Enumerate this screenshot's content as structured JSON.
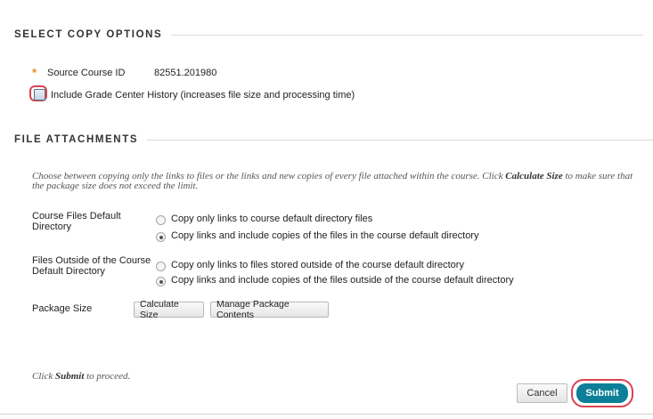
{
  "copy_options": {
    "heading": "SELECT COPY OPTIONS",
    "source_course_label": "Source Course ID",
    "source_course_id": "82551.201980",
    "required_mark": "*",
    "grade_center_history_label": "Include Grade Center History (increases file size and processing time)",
    "grade_center_history_checked": false
  },
  "file_attachments": {
    "heading": "FILE ATTACHMENTS",
    "instructions_part1": "Choose between copying only the links to files or the links and new copies of every file attached within the course. Click ",
    "instructions_bold": "Calculate Size",
    "instructions_part2": " to make sure that the package size does not exceed the limit.",
    "default_dir": {
      "label": "Course Files Default Directory",
      "option_links_only": "Copy only links to course default directory files",
      "option_copies": "Copy links and include copies of the files in the course default directory",
      "selected": "copies"
    },
    "outside_dir": {
      "label": "Files Outside of the Course Default Directory",
      "option_links_only": "Copy only links to files stored outside of the course default directory",
      "option_copies": "Copy links and include copies of the files outside of the course default directory",
      "selected": "copies"
    },
    "package_size": {
      "label": "Package Size",
      "calculate_button": "Calculate Size",
      "manage_button": "Manage Package Contents"
    }
  },
  "footer": {
    "proceed_prefix": "Click ",
    "proceed_bold": "Submit",
    "proceed_suffix": " to proceed.",
    "cancel_label": "Cancel",
    "submit_label": "Submit"
  },
  "colors": {
    "accent_required": "#e98a1c",
    "highlight_ring": "#d94350",
    "submit_bg": "#0d7f99"
  }
}
